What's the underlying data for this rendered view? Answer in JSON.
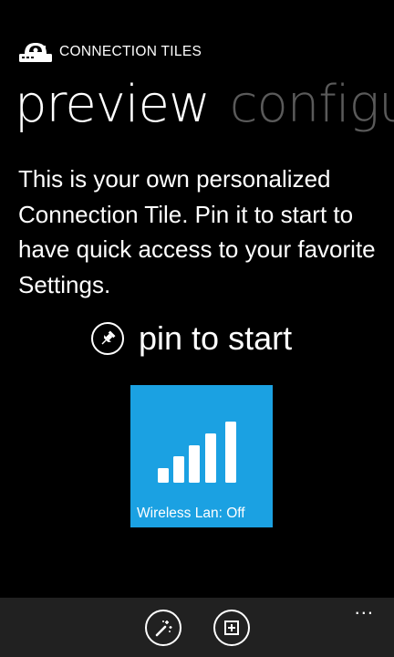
{
  "app": {
    "title": "CONNECTION TILES",
    "logo_icon": "router-logo-icon"
  },
  "pivot": {
    "active_label": "preview",
    "inactive_label": "configure",
    "inactive_visible_text": "configu"
  },
  "description": "This is your own personalized Connection Tile. Pin it to start to have quick access to your favorite Settings.",
  "pin": {
    "label": "pin to start",
    "icon": "pin-icon"
  },
  "tile": {
    "label": "Wireless Lan: Off",
    "background": "#1ba1e2",
    "icon": "signal-bars-icon"
  },
  "app_bar": {
    "buttons": [
      {
        "icon": "magic-wand-icon"
      },
      {
        "icon": "save-icon"
      }
    ],
    "more": "..."
  },
  "colors": {
    "background": "#000000",
    "foreground": "#ffffff",
    "inactive_pivot": "#5a5a5a",
    "accent": "#1ba1e2",
    "app_bar": "#212121"
  }
}
